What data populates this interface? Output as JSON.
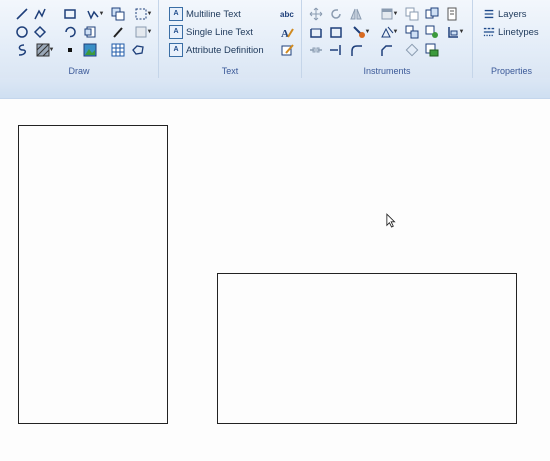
{
  "ribbon": {
    "panels": {
      "draw": {
        "title": "Draw"
      },
      "text": {
        "title": "Text",
        "buttons": [
          {
            "label": "Multiline Text"
          },
          {
            "label": "Single Line Text"
          },
          {
            "label": "Attribute Definition"
          }
        ]
      },
      "instruments": {
        "title": "Instruments"
      },
      "properties": {
        "title": "Properties",
        "buttons": [
          {
            "label": "Layers"
          },
          {
            "label": "Linetypes"
          }
        ]
      }
    }
  },
  "icons": {
    "draw": [
      "line-icon",
      "polyline-icon",
      "rectangle-icon",
      "spline-dropdown-icon",
      "hatch-boundary-icon",
      "region-dropdown-icon",
      "circle-icon",
      "ellipse-icon",
      "arc-icon",
      "table-insert-icon",
      "brush-icon",
      "fill-dropdown-icon",
      "freehand-icon",
      "hatch-dropdown-icon",
      "point-icon",
      "image-icon",
      "grid-table-icon",
      "revcloud-icon"
    ],
    "text": [
      "text-style-icon",
      "edit-text-icon",
      "attribute-edit-icon"
    ],
    "instruments": [
      "move-icon",
      "rotate-icon",
      "mirror-icon",
      "block-dropdown-icon",
      "copy-icon",
      "array-icon",
      "trim-icon",
      "measure-icon",
      "dimension-icon",
      "paint-dropdown-icon",
      "scale-dropdown-icon",
      "explode-icon",
      "offset-icon",
      "align-dropdown-icon",
      "break-icon",
      "join-icon",
      "fillet-icon",
      "chamfer-icon",
      "stretch-icon",
      "export-icon"
    ]
  }
}
